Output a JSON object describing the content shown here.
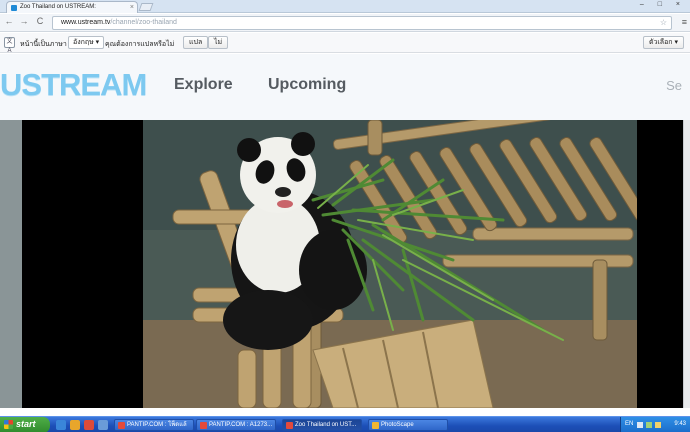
{
  "browser": {
    "tab_title": "Zoo Thailand on USTREAM: ",
    "tab_close": "×",
    "window_controls": "– □ ×",
    "back_icon": "←",
    "forward_icon": "→",
    "reload_icon": "C",
    "url_host": "www.ustream.tv",
    "url_path": "/channel/zoo-thailand",
    "star_icon": "☆",
    "menu_icon": "≡"
  },
  "translate_bar": {
    "icon_text": "文A",
    "prompt": "หน้านี้เป็นภาษา",
    "language": "อังกฤษ ▾",
    "question": "คุณต้องการแปลหรือไม่",
    "translate_button": "แปล",
    "no_button": "ไม่",
    "options_button": "ตัวเลือก ▾"
  },
  "site": {
    "logo": "USTREAM",
    "nav": [
      "Explore",
      "Upcoming"
    ],
    "search_stub": "Se"
  },
  "taskbar": {
    "start_label": "start",
    "tasks": [
      {
        "label": "PANTIP.COM : โพ็ดแล้",
        "active": false
      },
      {
        "label": "PANTIP.COM : A1273...",
        "active": false
      },
      {
        "label": "Zoo Thailand on UST...",
        "active": true
      },
      {
        "label": "PhotoScape",
        "active": false
      }
    ],
    "lang": "EN",
    "clock": "9:43"
  },
  "colors": {
    "logo": "#7dc9f0",
    "nav_text": "#555b61",
    "taskbar": "#2459c4",
    "start": "#3a9c36"
  }
}
